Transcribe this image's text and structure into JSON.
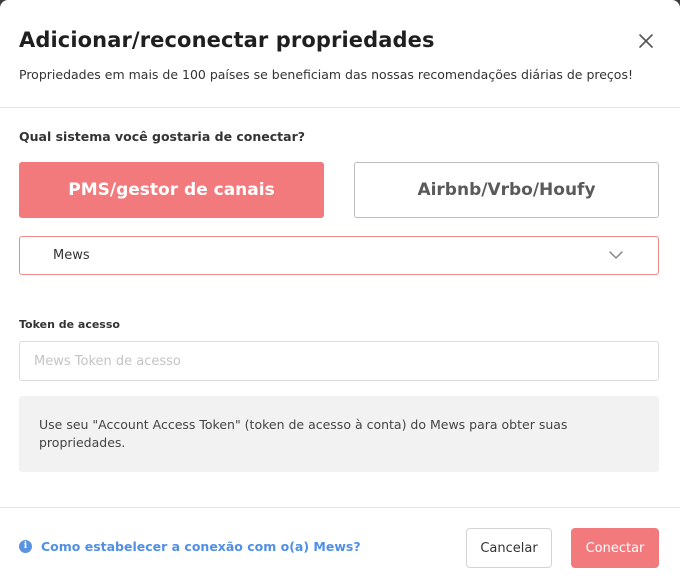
{
  "modal": {
    "title": "Adicionar/reconectar propriedades",
    "subtitle": "Propriedades em mais de 100 países se beneficiam das nossas recomendações diárias de preços!",
    "close_icon": "close-icon"
  },
  "form": {
    "question": "Qual sistema você gostaria de conectar?",
    "options": [
      {
        "label": "PMS/gestor de canais",
        "selected": true
      },
      {
        "label": "Airbnb/Vrbo/Houfy",
        "selected": false
      }
    ],
    "select": {
      "value": "Mews",
      "icon": "chevron-down-icon"
    },
    "token": {
      "label": "Token de acesso",
      "value": "",
      "placeholder": "Mews Token de acesso"
    },
    "info_text": "Use seu \"Account Access Token\" (token de acesso à conta) do Mews para obter suas propriedades."
  },
  "footer": {
    "help_icon": "info-icon",
    "help_link": "Como estabelecer a conexão com o(a) Mews?",
    "cancel_label": "Cancelar",
    "connect_label": "Conectar"
  },
  "colors": {
    "accent": "#f27a7d",
    "link": "#4f8fe6",
    "info_background": "#f2f2f3"
  }
}
